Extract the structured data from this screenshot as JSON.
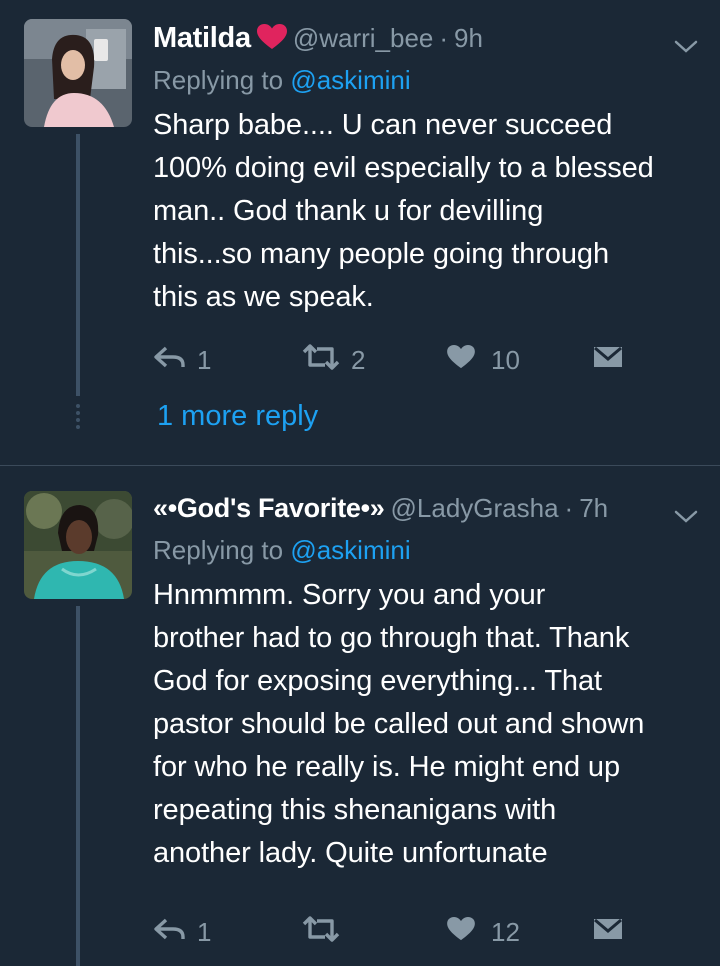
{
  "tweets": [
    {
      "name": "Matilda",
      "badge_icon": "heart-icon",
      "handle": "@warri_bee",
      "time": "9h",
      "replying_prefix": "Replying to",
      "replying_to": "@askimini",
      "text": "Sharp babe.... U can never succeed\n100% doing evil especially to a blessed\nman.. God thank u for devilling\nthis...so many people going through\nthis as we speak.",
      "actions": {
        "reply_count": "1",
        "retweet_count": "2",
        "like_count": "10"
      },
      "more_replies": "1 more reply"
    },
    {
      "name": "«•God's Favorite•»",
      "handle": "@LadyGrasha",
      "time": "7h",
      "replying_prefix": "Replying to",
      "replying_to": "@askimini",
      "text": "Hnmmmm. Sorry you and your\nbrother had to go through that. Thank\nGod for exposing everything... That\npastor should be called out and shown\nfor who he really is. He might end up\nrepeating this shenanigans with\nanother lady. Quite unfortunate",
      "actions": {
        "reply_count": "1",
        "retweet_count": "",
        "like_count": "12"
      }
    }
  ],
  "colors": {
    "background": "#1b2836",
    "secondary_text": "#8899a6",
    "link": "#1da1f2",
    "heart_badge": "#e0245e",
    "thread_line": "#3d5166"
  },
  "icons": [
    "reply-icon",
    "retweet-icon",
    "like-icon",
    "direct-message-icon",
    "chevron-down-icon"
  ]
}
